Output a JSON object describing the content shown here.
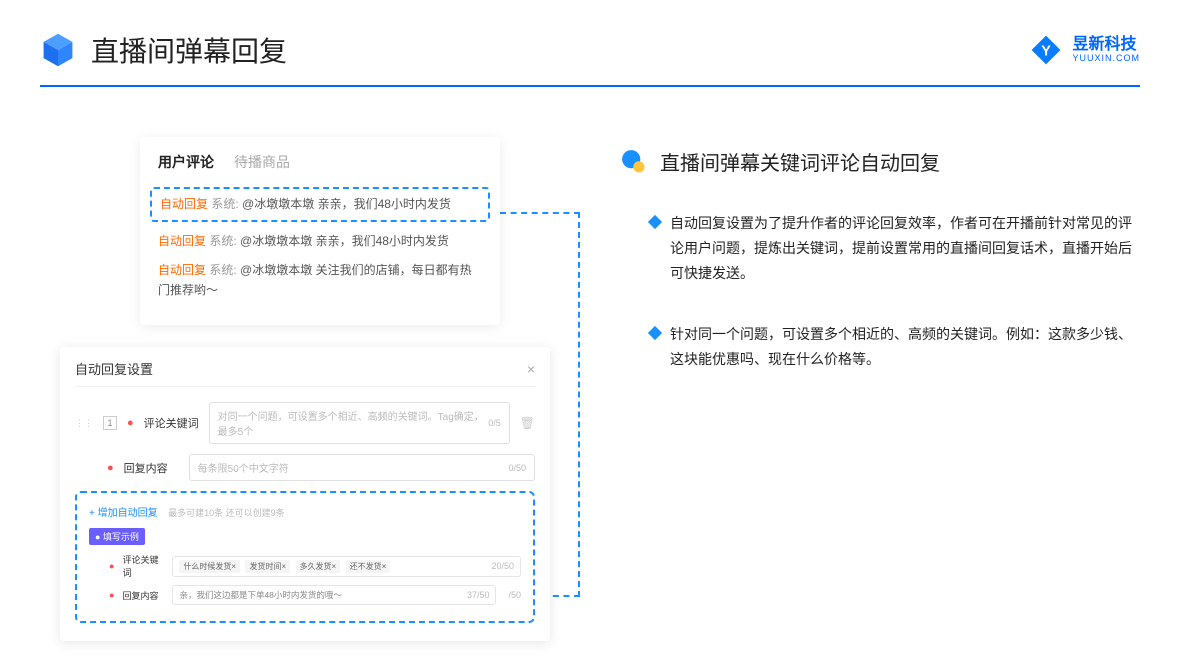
{
  "header": {
    "title": "直播间弹幕回复",
    "brand_name": "昱新科技",
    "brand_url": "YUUXIN.COM"
  },
  "comments": {
    "tab_active": "用户评论",
    "tab_inactive": "待播商品",
    "auto_tag": "自动回复",
    "row1_sys": "系统:",
    "row1_text": "@冰墩墩本墩 亲亲，我们48小时内发货",
    "row2_sys": "系统:",
    "row2_text": "@冰墩墩本墩 亲亲，我们48小时内发货",
    "row3_sys": "系统:",
    "row3_text": "@冰墩墩本墩 关注我们的店铺，每日都有热门推荐哟～"
  },
  "settings": {
    "title": "自动回复设置",
    "close": "×",
    "num1": "1",
    "label_keyword": "评论关键词",
    "placeholder_keyword": "对同一个问题，可设置多个相近、高频的关键词。Tag确定，最多5个",
    "count_keyword": "0/5",
    "label_reply": "回复内容",
    "placeholder_reply": "每条限50个中文字符",
    "count_reply": "0/50",
    "add_link": "+ 增加自动回复",
    "add_hint": "最多可建10条 还可以创建9条",
    "example_badge": "● 填写示例",
    "ex_kw_label": "评论关键词",
    "ex_tags": [
      "什么时候发货×",
      "发货时间×",
      "多久发货×",
      "还不发货×"
    ],
    "ex_kw_count": "20/50",
    "ex_reply_label": "回复内容",
    "ex_reply_text": "亲，我们这边都是下单48小时内发货的哦～",
    "ex_reply_count": "37/50",
    "outer_count": "/50"
  },
  "right": {
    "section_title": "直播间弹幕关键词评论自动回复",
    "bullet1": "自动回复设置为了提升作者的评论回复效率，作者可在开播前针对常见的评论用户问题，提炼出关键词，提前设置常用的直播间回复话术，直播开始后可快捷发送。",
    "bullet2": "针对同一个问题，可设置多个相近的、高频的关键词。例如：这款多少钱、这块能优惠吗、现在什么价格等。"
  }
}
